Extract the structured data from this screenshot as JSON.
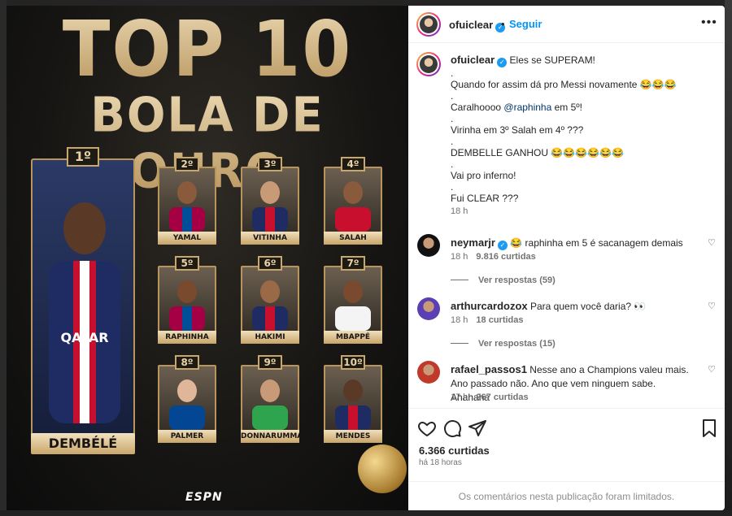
{
  "post_image": {
    "title_line1": "TOP 10",
    "title_line2": "BOLA DE OURO",
    "winner": {
      "rank": "1º",
      "name": "DEMBÉLÉ"
    },
    "players": [
      {
        "rank": "2º",
        "name": "YAMAL"
      },
      {
        "rank": "3º",
        "name": "VITINHA"
      },
      {
        "rank": "4º",
        "name": "SALAH"
      },
      {
        "rank": "5º",
        "name": "RAPHINHA"
      },
      {
        "rank": "6º",
        "name": "HAKIMI"
      },
      {
        "rank": "7º",
        "name": "MBAPPÉ"
      },
      {
        "rank": "8º",
        "name": "PALMER"
      },
      {
        "rank": "9º",
        "name": "DONNARUMMA"
      },
      {
        "rank": "10º",
        "name": "MENDES"
      }
    ],
    "brand": "ESPN"
  },
  "header": {
    "username": "ofuiclear",
    "dot": "•",
    "follow_label": "Seguir",
    "more_label": "•••"
  },
  "caption": {
    "username": "ofuiclear",
    "lines": [
      "Eles se SUPERAM!",
      ".",
      "Quando for assim dá pro Messi novamente 😂😂😂",
      ".",
      "Caralhoooo ",
      ".",
      "Virinha em 3º Salah em 4º ???",
      ".",
      "DEMBELLE GANHOU 😂😂😂😂😂😂",
      ".",
      "Vai pro inferno!",
      ".",
      "Fui CLEAR ???"
    ],
    "mention": "@raphinha",
    "mention_suffix": " em 5º!",
    "time": "18 h"
  },
  "comments": [
    {
      "username": "neymarjr",
      "verified": true,
      "text": "😂 raphinha em 5 é sacanagem demais",
      "time": "18 h",
      "likes": "9.816 curtidas",
      "replies": "Ver respostas (59)"
    },
    {
      "username": "arthurcardozox",
      "verified": false,
      "text": "Para quem você daria? 👀",
      "time": "18 h",
      "likes": "18 curtidas",
      "replies": "Ver respostas (15)"
    },
    {
      "username": "rafael_passos1",
      "verified": false,
      "text": "Nesse ano a Champions valeu mais. Ano passado não. Ano que vem ninguem sabe. Ahahaha",
      "time": "17 h",
      "likes": "267 curtidas",
      "replies": ""
    }
  ],
  "actions": {
    "likes": "6.366 curtidas",
    "time_ago": "há 18 horas",
    "limited_notice": "Os comentários nesta publicação foram limitados."
  },
  "colors": {
    "link": "#0095f6",
    "gold": "#c8a76d",
    "verified": "#1d9bf0"
  },
  "icons": [
    "verified-icon",
    "more-icon",
    "heart-icon",
    "comment-icon",
    "share-icon",
    "bookmark-icon"
  ]
}
